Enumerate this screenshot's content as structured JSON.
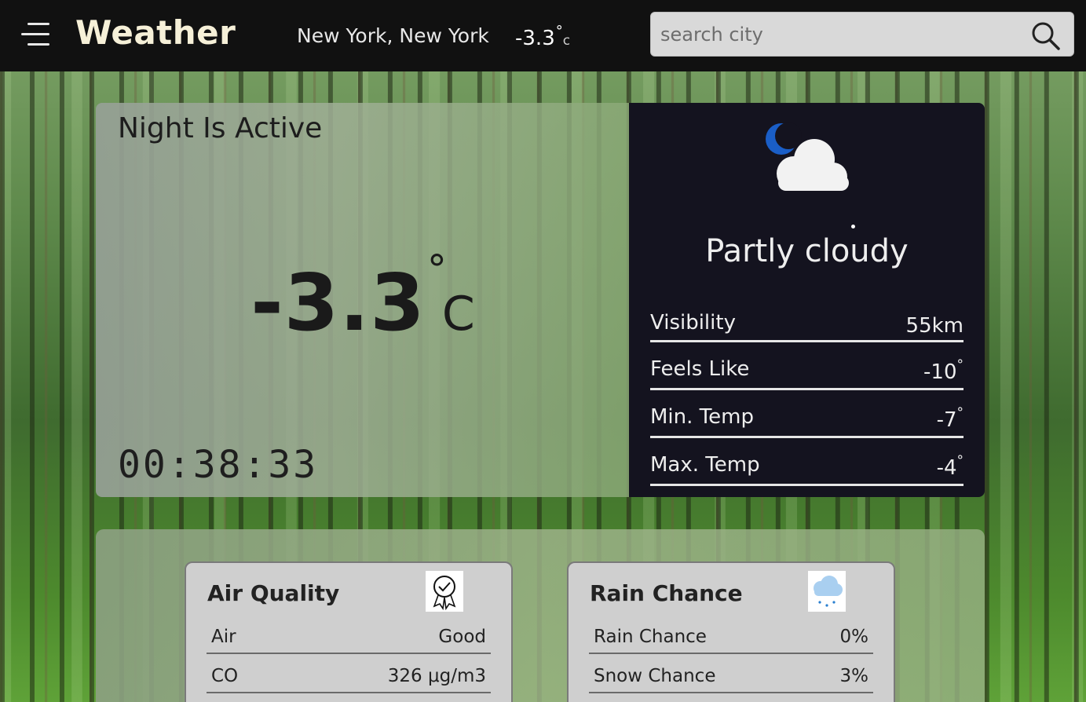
{
  "header": {
    "app_title": "Weather",
    "location": "New York, New York",
    "temp": "-3.3",
    "deg": "°",
    "unit": "c",
    "search_placeholder": "search city"
  },
  "main": {
    "status_title": "Night Is Active",
    "temperature": "-3.3",
    "deg": "°",
    "unit": "C",
    "clock": "00:38:33"
  },
  "condition": {
    "icon": "moon-cloud-icon",
    "text": "Partly cloudy",
    "stats": [
      {
        "label": "Visibility",
        "value": "55km",
        "deg": ""
      },
      {
        "label": "Feels Like",
        "value": "-10",
        "deg": "°"
      },
      {
        "label": "Min. Temp",
        "value": "-7",
        "deg": "°"
      },
      {
        "label": "Max. Temp",
        "value": "-4",
        "deg": "°"
      }
    ]
  },
  "air_quality": {
    "title": "Air Quality",
    "icon": "award-badge-icon",
    "rows": [
      {
        "label": "Air",
        "value": "Good"
      },
      {
        "label": "CO",
        "value": "326 μg/m3"
      }
    ]
  },
  "rain_chance": {
    "title": "Rain Chance",
    "icon": "rain-cloud-icon",
    "rows": [
      {
        "label": "Rain Chance",
        "value": "0%"
      },
      {
        "label": "Snow Chance",
        "value": "3%"
      }
    ]
  },
  "colors": {
    "header_bg": "#111111",
    "title_color": "#f6f0d8",
    "condition_bg": "#14131f",
    "moon_blue": "#1a5ec7"
  }
}
